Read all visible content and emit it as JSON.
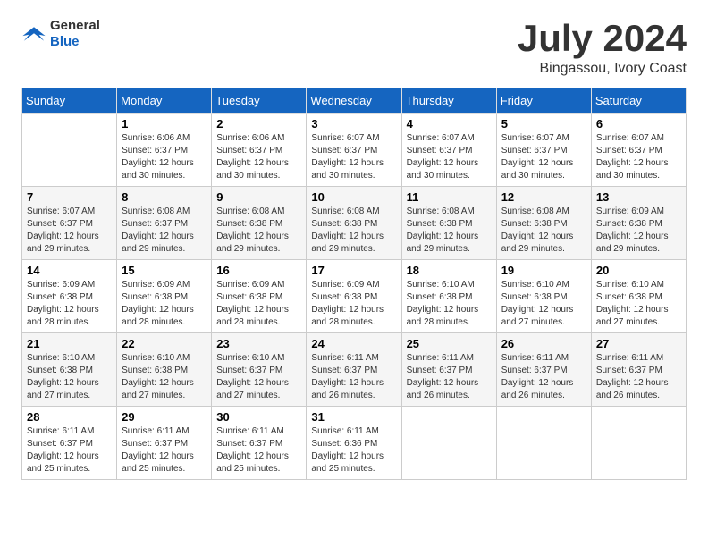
{
  "logo": {
    "general": "General",
    "blue": "Blue"
  },
  "title": "July 2024",
  "location": "Bingassou, Ivory Coast",
  "days_of_week": [
    "Sunday",
    "Monday",
    "Tuesday",
    "Wednesday",
    "Thursday",
    "Friday",
    "Saturday"
  ],
  "weeks": [
    [
      {
        "day": "",
        "empty": true
      },
      {
        "day": "1",
        "sunrise": "6:06 AM",
        "sunset": "6:37 PM",
        "daylight": "12 hours and 30 minutes."
      },
      {
        "day": "2",
        "sunrise": "6:06 AM",
        "sunset": "6:37 PM",
        "daylight": "12 hours and 30 minutes."
      },
      {
        "day": "3",
        "sunrise": "6:07 AM",
        "sunset": "6:37 PM",
        "daylight": "12 hours and 30 minutes."
      },
      {
        "day": "4",
        "sunrise": "6:07 AM",
        "sunset": "6:37 PM",
        "daylight": "12 hours and 30 minutes."
      },
      {
        "day": "5",
        "sunrise": "6:07 AM",
        "sunset": "6:37 PM",
        "daylight": "12 hours and 30 minutes."
      },
      {
        "day": "6",
        "sunrise": "6:07 AM",
        "sunset": "6:37 PM",
        "daylight": "12 hours and 30 minutes."
      }
    ],
    [
      {
        "day": "7",
        "sunrise": "6:07 AM",
        "sunset": "6:37 PM",
        "daylight": "12 hours and 29 minutes."
      },
      {
        "day": "8",
        "sunrise": "6:08 AM",
        "sunset": "6:37 PM",
        "daylight": "12 hours and 29 minutes."
      },
      {
        "day": "9",
        "sunrise": "6:08 AM",
        "sunset": "6:38 PM",
        "daylight": "12 hours and 29 minutes."
      },
      {
        "day": "10",
        "sunrise": "6:08 AM",
        "sunset": "6:38 PM",
        "daylight": "12 hours and 29 minutes."
      },
      {
        "day": "11",
        "sunrise": "6:08 AM",
        "sunset": "6:38 PM",
        "daylight": "12 hours and 29 minutes."
      },
      {
        "day": "12",
        "sunrise": "6:08 AM",
        "sunset": "6:38 PM",
        "daylight": "12 hours and 29 minutes."
      },
      {
        "day": "13",
        "sunrise": "6:09 AM",
        "sunset": "6:38 PM",
        "daylight": "12 hours and 29 minutes."
      }
    ],
    [
      {
        "day": "14",
        "sunrise": "6:09 AM",
        "sunset": "6:38 PM",
        "daylight": "12 hours and 28 minutes."
      },
      {
        "day": "15",
        "sunrise": "6:09 AM",
        "sunset": "6:38 PM",
        "daylight": "12 hours and 28 minutes."
      },
      {
        "day": "16",
        "sunrise": "6:09 AM",
        "sunset": "6:38 PM",
        "daylight": "12 hours and 28 minutes."
      },
      {
        "day": "17",
        "sunrise": "6:09 AM",
        "sunset": "6:38 PM",
        "daylight": "12 hours and 28 minutes."
      },
      {
        "day": "18",
        "sunrise": "6:10 AM",
        "sunset": "6:38 PM",
        "daylight": "12 hours and 28 minutes."
      },
      {
        "day": "19",
        "sunrise": "6:10 AM",
        "sunset": "6:38 PM",
        "daylight": "12 hours and 27 minutes."
      },
      {
        "day": "20",
        "sunrise": "6:10 AM",
        "sunset": "6:38 PM",
        "daylight": "12 hours and 27 minutes."
      }
    ],
    [
      {
        "day": "21",
        "sunrise": "6:10 AM",
        "sunset": "6:38 PM",
        "daylight": "12 hours and 27 minutes."
      },
      {
        "day": "22",
        "sunrise": "6:10 AM",
        "sunset": "6:38 PM",
        "daylight": "12 hours and 27 minutes."
      },
      {
        "day": "23",
        "sunrise": "6:10 AM",
        "sunset": "6:37 PM",
        "daylight": "12 hours and 27 minutes."
      },
      {
        "day": "24",
        "sunrise": "6:11 AM",
        "sunset": "6:37 PM",
        "daylight": "12 hours and 26 minutes."
      },
      {
        "day": "25",
        "sunrise": "6:11 AM",
        "sunset": "6:37 PM",
        "daylight": "12 hours and 26 minutes."
      },
      {
        "day": "26",
        "sunrise": "6:11 AM",
        "sunset": "6:37 PM",
        "daylight": "12 hours and 26 minutes."
      },
      {
        "day": "27",
        "sunrise": "6:11 AM",
        "sunset": "6:37 PM",
        "daylight": "12 hours and 26 minutes."
      }
    ],
    [
      {
        "day": "28",
        "sunrise": "6:11 AM",
        "sunset": "6:37 PM",
        "daylight": "12 hours and 25 minutes."
      },
      {
        "day": "29",
        "sunrise": "6:11 AM",
        "sunset": "6:37 PM",
        "daylight": "12 hours and 25 minutes."
      },
      {
        "day": "30",
        "sunrise": "6:11 AM",
        "sunset": "6:37 PM",
        "daylight": "12 hours and 25 minutes."
      },
      {
        "day": "31",
        "sunrise": "6:11 AM",
        "sunset": "6:36 PM",
        "daylight": "12 hours and 25 minutes."
      },
      {
        "day": "",
        "empty": true
      },
      {
        "day": "",
        "empty": true
      },
      {
        "day": "",
        "empty": true
      }
    ]
  ],
  "labels": {
    "sunrise": "Sunrise:",
    "sunset": "Sunset:",
    "daylight": "Daylight:"
  }
}
